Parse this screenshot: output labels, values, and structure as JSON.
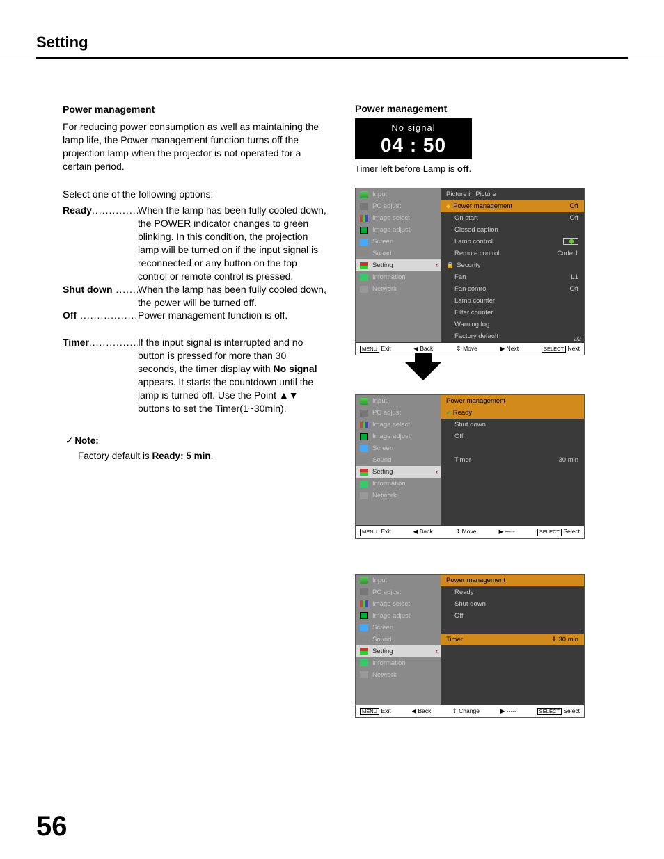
{
  "header": {
    "title": "Setting"
  },
  "page_number": "56",
  "section": {
    "title": "Power management",
    "intro": "For reducing power consumption as well as maintaining the lamp life, the Power management function turns off the projection lamp when the projector is not operated for a certain period.",
    "select_prompt": "Select one of the following options:",
    "options": {
      "ready": {
        "term": "Ready",
        "desc": "When the lamp has been fully cooled down, the POWER indicator changes to green blinking. In this condition, the projection lamp will be turned on if the input signal is reconnected or any button on the top control or remote control is pressed."
      },
      "shutdown": {
        "term": "Shut down",
        "desc": "When the lamp has been fully cooled down, the power will be turned off."
      },
      "off": {
        "term": "Off",
        "desc": "Power management function is off."
      },
      "timer": {
        "term": "Timer",
        "desc_pre": "If the input signal is interrupted and no button is pressed for more than 30 seconds, the timer display with ",
        "desc_bold": "No signal",
        "desc_post": " appears. It starts the countdown until the lamp is turned off. Use the Point ",
        "arrows": "▲▼",
        "desc_tail": " buttons to set the Timer(1~30min)."
      }
    },
    "note": {
      "label": "Note:",
      "body_pre": "Factory default is ",
      "body_bold": "Ready: 5 min",
      "body_post": "."
    }
  },
  "right": {
    "title": "Power management",
    "timer_box": {
      "no_signal": "No signal",
      "clock": "04 : 50"
    },
    "timer_caption_pre": "Timer left before Lamp is ",
    "timer_caption_bold": "off",
    "timer_caption_post": "."
  },
  "osd_side": {
    "input": "Input",
    "pc": "PC adjust",
    "imgsel": "Image select",
    "imgadj": "Image adjust",
    "screen": "Screen",
    "sound": "Sound",
    "setting": "Setting",
    "info": "Information",
    "network": "Network"
  },
  "osd1": {
    "rows": {
      "pip": "Picture in Picture",
      "pm": "Power management",
      "pm_val": "Off",
      "onstart": "On start",
      "onstart_val": "Off",
      "cc": "Closed caption",
      "lamp": "Lamp control",
      "rc": "Remote control",
      "rc_val": "Code 1",
      "sec": "Security",
      "fan": "Fan",
      "fan_val": "L1",
      "fanc": "Fan control",
      "fanc_val": "Off",
      "lampcnt": "Lamp counter",
      "filter": "Filter counter",
      "warn": "Warning log",
      "factory": "Factory default"
    },
    "page": "2/2",
    "foot": {
      "exit": "Exit",
      "back": "Back",
      "move": "Move",
      "next": "Next",
      "select": "Next",
      "menu": "MENU",
      "sel": "SELECT"
    }
  },
  "osd2": {
    "title": "Power management",
    "rows": {
      "ready": "Ready",
      "shutdown": "Shut down",
      "off": "Off",
      "timer": "Timer",
      "timer_val": "30",
      "timer_unit": "min"
    },
    "foot": {
      "exit": "Exit",
      "back": "Back",
      "move": "Move",
      "next": "-----",
      "select": "Select",
      "menu": "MENU",
      "sel": "SELECT"
    }
  },
  "osd3": {
    "title": "Power management",
    "rows": {
      "ready": "Ready",
      "shutdown": "Shut down",
      "off": "Off",
      "timer": "Timer",
      "timer_val": "30",
      "timer_unit": "min"
    },
    "foot": {
      "exit": "Exit",
      "back": "Back",
      "change": "Change",
      "next": "-----",
      "select": "Select",
      "menu": "MENU",
      "sel": "SELECT"
    }
  }
}
